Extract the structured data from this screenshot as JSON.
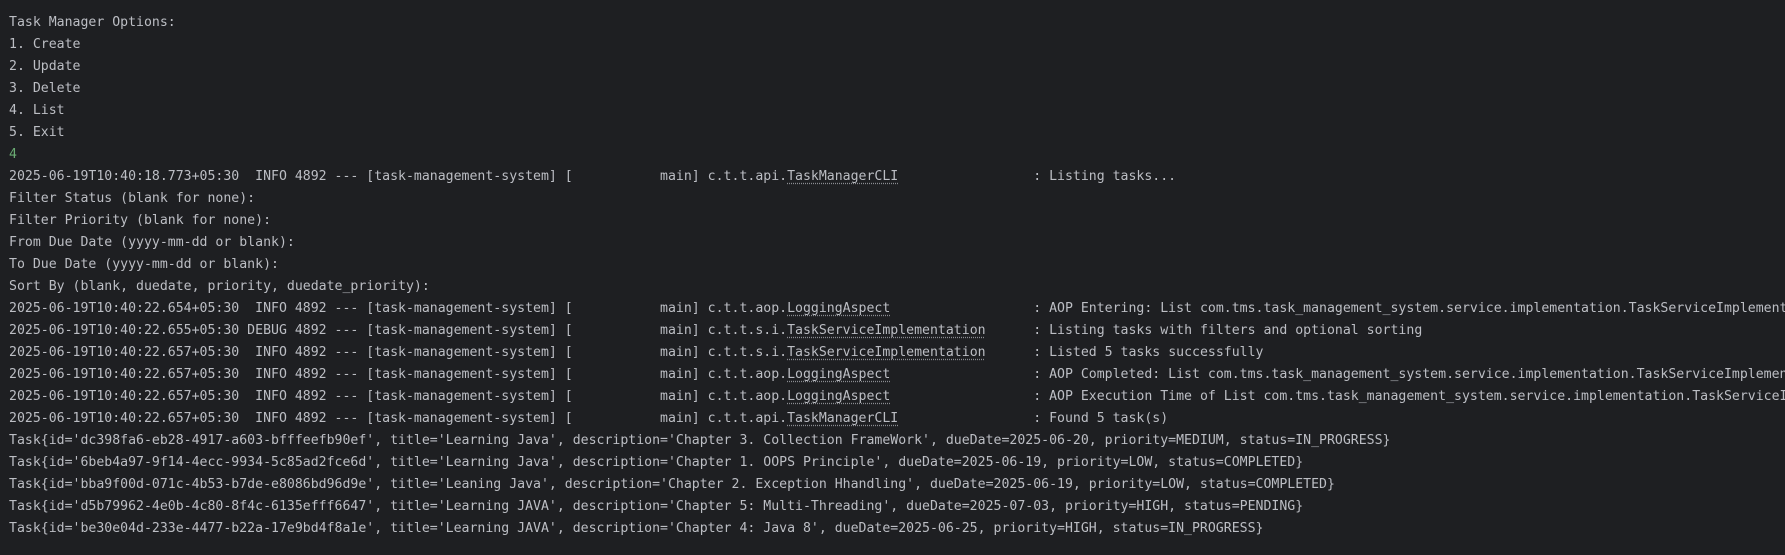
{
  "console": {
    "menu": [
      "Task Manager Options:",
      "1. Create",
      "2. Update",
      "3. Delete",
      "4. List",
      "5. Exit"
    ],
    "user_input": "4",
    "log_listing": {
      "prefix": "2025-06-19T10:40:18.773+05:30  INFO 4892 --- [task-management-system] [           main] c.t.t.api.",
      "logger": "TaskManagerCLI",
      "message": "                 : Listing tasks..."
    },
    "prompts": [
      "Filter Status (blank for none):",
      "Filter Priority (blank for none):",
      "From Due Date (yyyy-mm-dd or blank):",
      "To Due Date (yyyy-mm-dd or blank):",
      "Sort By (blank, duedate, priority, duedate_priority):"
    ],
    "logs": [
      {
        "prefix": "2025-06-19T10:40:22.654+05:30  INFO 4892 --- [task-management-system] [           main] c.t.t.aop.",
        "logger": "LoggingAspect",
        "message": "                  : AOP Entering: List com.tms.task_management_system.service.implementation.TaskServiceImplementation"
      },
      {
        "prefix": "2025-06-19T10:40:22.655+05:30 DEBUG 4892 --- [task-management-system] [           main] c.t.t.s.i.",
        "logger": "TaskServiceImplementation",
        "message": "      : Listing tasks with filters and optional sorting"
      },
      {
        "prefix": "2025-06-19T10:40:22.657+05:30  INFO 4892 --- [task-management-system] [           main] c.t.t.s.i.",
        "logger": "TaskServiceImplementation",
        "message": "      : Listed 5 tasks successfully"
      },
      {
        "prefix": "2025-06-19T10:40:22.657+05:30  INFO 4892 --- [task-management-system] [           main] c.t.t.aop.",
        "logger": "LoggingAspect",
        "message": "                  : AOP Completed: List com.tms.task_management_system.service.implementation.TaskServiceImplementation"
      },
      {
        "prefix": "2025-06-19T10:40:22.657+05:30  INFO 4892 --- [task-management-system] [           main] c.t.t.aop.",
        "logger": "LoggingAspect",
        "message": "                  : AOP Execution Time of List com.tms.task_management_system.service.implementation.TaskServiceImplementation"
      },
      {
        "prefix": "2025-06-19T10:40:22.657+05:30  INFO 4892 --- [task-management-system] [           main] c.t.t.api.",
        "logger": "TaskManagerCLI",
        "message": "                 : Found 5 task(s)"
      }
    ],
    "tasks": [
      "Task{id='dc398fa6-eb28-4917-a603-bfffeefb90ef', title='Learning Java', description='Chapter 3. Collection FrameWork', dueDate=2025-06-20, priority=MEDIUM, status=IN_PROGRESS}",
      "Task{id='6beb4a97-9f14-4ecc-9934-5c85ad2fce6d', title='Learning Java', description='Chapter 1. OOPS Principle', dueDate=2025-06-19, priority=LOW, status=COMPLETED}",
      "Task{id='bba9f00d-071c-4b53-b7de-e8086bd96d9e', title='Leaning Java', description='Chapter 2. Exception Hhandling', dueDate=2025-06-19, priority=LOW, status=COMPLETED}",
      "Task{id='d5b79962-4e0b-4c80-8f4c-6135efff6647', title='Learning JAVA', description='Chapter 5: Multi-Threading', dueDate=2025-07-03, priority=HIGH, status=PENDING}",
      "Task{id='be30e04d-233e-4477-b22a-17e9bd4f8a1e', title='Learning JAVA', description='Chapter 4: Java 8', dueDate=2025-06-25, priority=HIGH, status=IN_PROGRESS}"
    ]
  },
  "colors": {
    "background": "#1e1f22",
    "text": "#bcbec4",
    "input_echo": "#6aab73"
  }
}
